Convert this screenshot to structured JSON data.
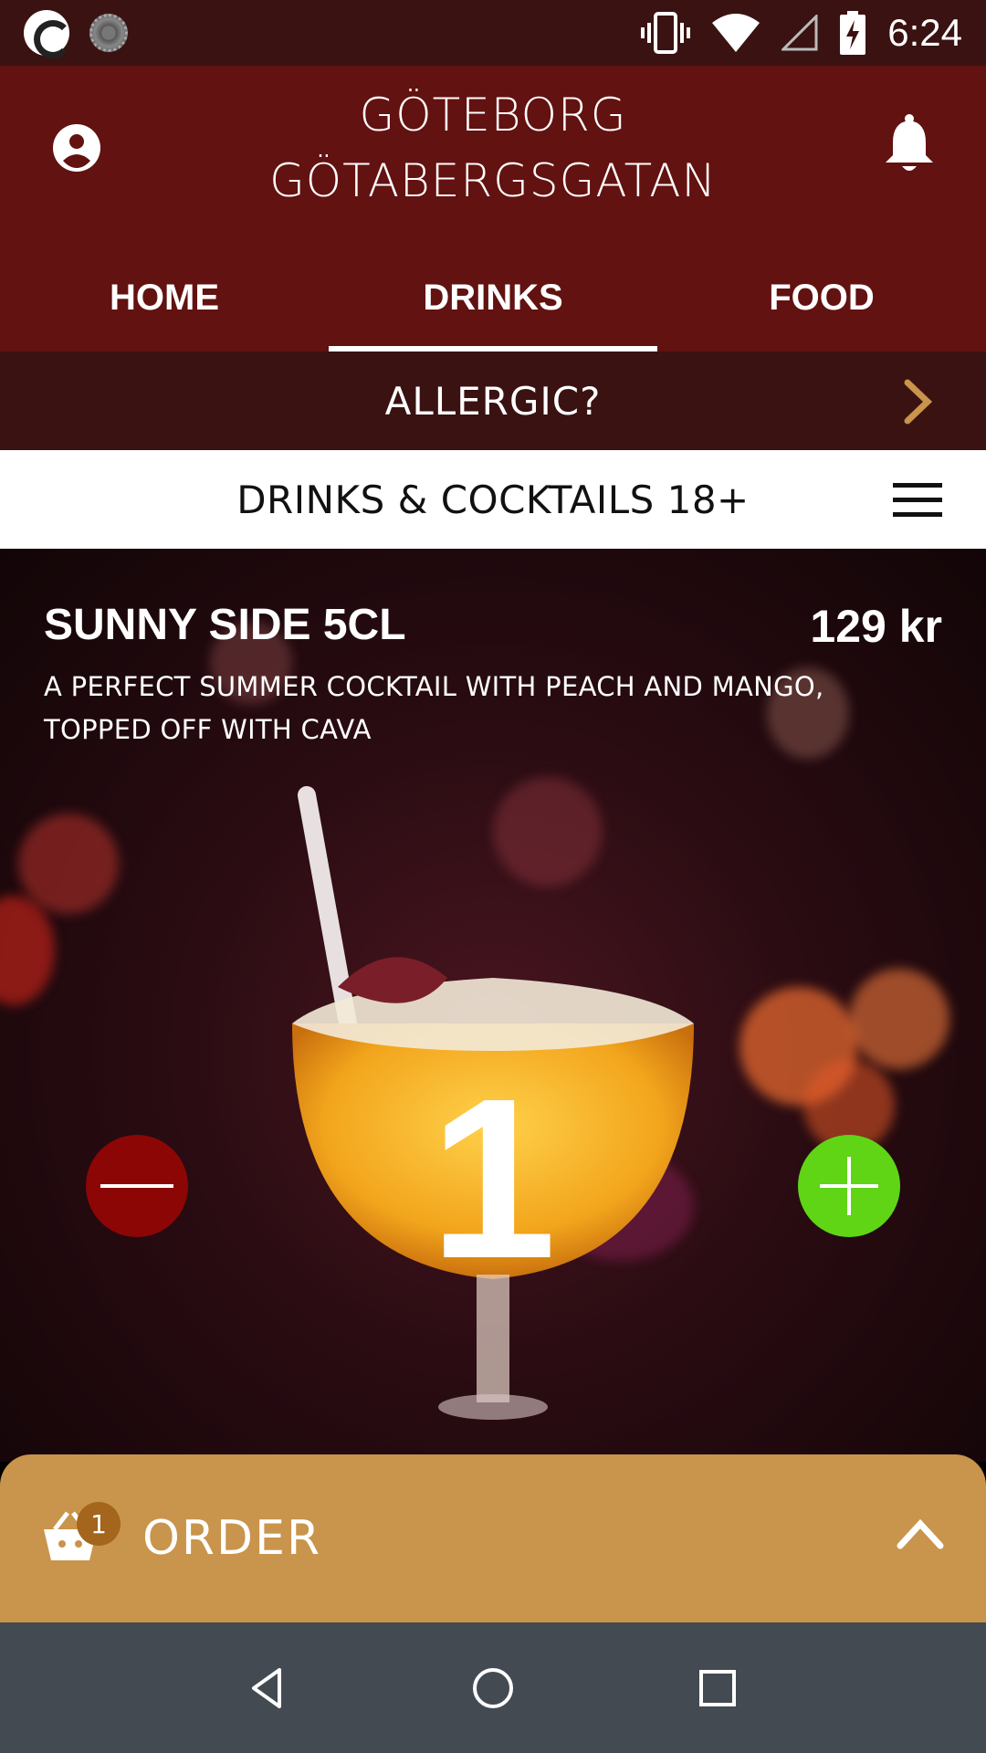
{
  "status_bar": {
    "time": "6:24",
    "icons": [
      "app-icon",
      "sync-icon",
      "vibrate-icon",
      "wifi-icon",
      "signal-icon",
      "battery-charging-icon"
    ]
  },
  "header": {
    "title_line1": "GÖTEBORG",
    "title_line2": "GÖTABERGSGATAN",
    "account_icon": "account-circle-icon",
    "notification_icon": "bell-icon"
  },
  "tabs": [
    {
      "label": "HOME",
      "active": false
    },
    {
      "label": "DRINKS",
      "active": true
    },
    {
      "label": "FOOD",
      "active": false
    }
  ],
  "allergy": {
    "label": "ALLERGIC?",
    "icon": "chevron-right-icon"
  },
  "category": {
    "title": "DRINKS & COCKTAILS 18+",
    "menu_icon": "hamburger-menu-icon"
  },
  "product": {
    "name": "SUNNY SIDE 5CL",
    "price": "129 kr",
    "description": "A PERFECT SUMMER COCKTAIL WITH PEACH AND MANGO, TOPPED OFF WITH CAVA",
    "quantity": "1",
    "minus_color": "#8c0606",
    "plus_color": "#5fd516"
  },
  "order": {
    "label": "ORDER",
    "count": "1",
    "icon": "basket-icon",
    "expand_icon": "chevron-up-icon"
  },
  "colors": {
    "header_bg": "#621210",
    "dark_bar_bg": "#3a1212",
    "order_bg": "#c9944b",
    "nav_bg": "#434a52",
    "accent_chevron": "#c9944b"
  }
}
